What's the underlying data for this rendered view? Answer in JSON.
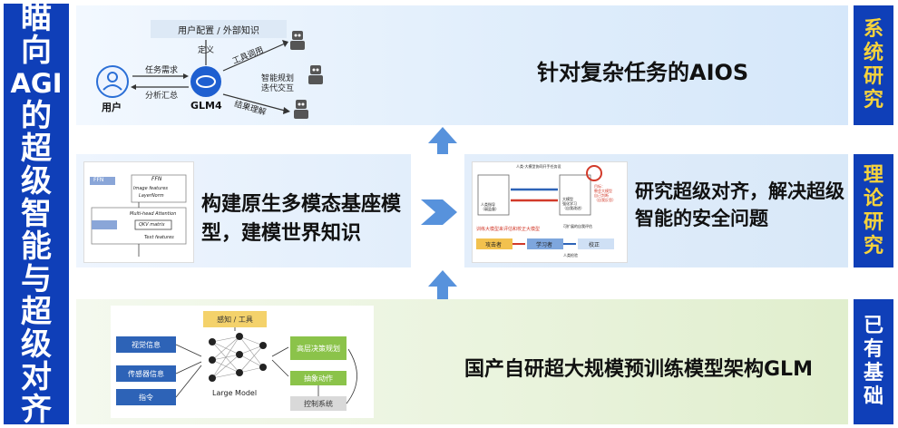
{
  "left_banner": [
    "瞄",
    "向",
    "AGI",
    "的",
    "超",
    "级",
    "智",
    "能",
    "与",
    "超",
    "级",
    "对",
    "齐"
  ],
  "tags": {
    "system": [
      "系",
      "统",
      "研",
      "究"
    ],
    "theory": [
      "理",
      "论",
      "研",
      "究"
    ],
    "base": [
      "已",
      "有",
      "基",
      "础"
    ]
  },
  "top": {
    "title": "针对复杂任务的AIOS",
    "config_label": "用户配置 / 外部知识",
    "user_label": "用户",
    "model_label": "GLM4",
    "task_need": "任务需求",
    "analysis": "分析汇总",
    "define": "定义",
    "tool_call": "工具调用",
    "planning": "智能规划\n迭代交互",
    "result": "结果理解"
  },
  "mid_left": {
    "text": "构建原生多模态基座模型，建模世界知识",
    "arch": {
      "ffn": "FFN",
      "ffn_img": "FFN",
      "mha": "Multi-head Attention",
      "qkv": "QKV matrix",
      "layernorm": "LayerNorm",
      "image_features": "Image features",
      "text_features": "Text features"
    }
  },
  "mid_right": {
    "text": "研究超级对齐，解决超级智能的安全问题",
    "diagram": {
      "top_caption": "人类-大模型协同开手任务设",
      "human": "人类指导\n（弱监督）",
      "ai": "大模型\n强化学习\n（自我改进）",
      "goal": "目标：\n教会大模型\n自己判断\n（自我反思）",
      "bottom_caption": "训练大模型来评估和校正大模型",
      "attacker": "攻击者",
      "learner": "学习者",
      "corrector": "校正",
      "human_check": "人类检验",
      "note": "可扩展的自我评估"
    }
  },
  "bottom": {
    "text": "国产自研超大规模预训练模型架构GLM",
    "diagram": {
      "tool": "感知 / 工具",
      "vision": "视觉信息",
      "sensor": "传感器信息",
      "command": "指令",
      "large_model": "Large Model",
      "planning": "高层决策规划",
      "action": "抽象动作",
      "control": "控制系统"
    }
  },
  "colors": {
    "banner_blue": "#0f3fb8",
    "tag_yellow": "#f6d33c",
    "arrow_blue": "#3a7fd6",
    "green_box": "#8bc34a",
    "dark_blue_box": "#2d63b7"
  }
}
